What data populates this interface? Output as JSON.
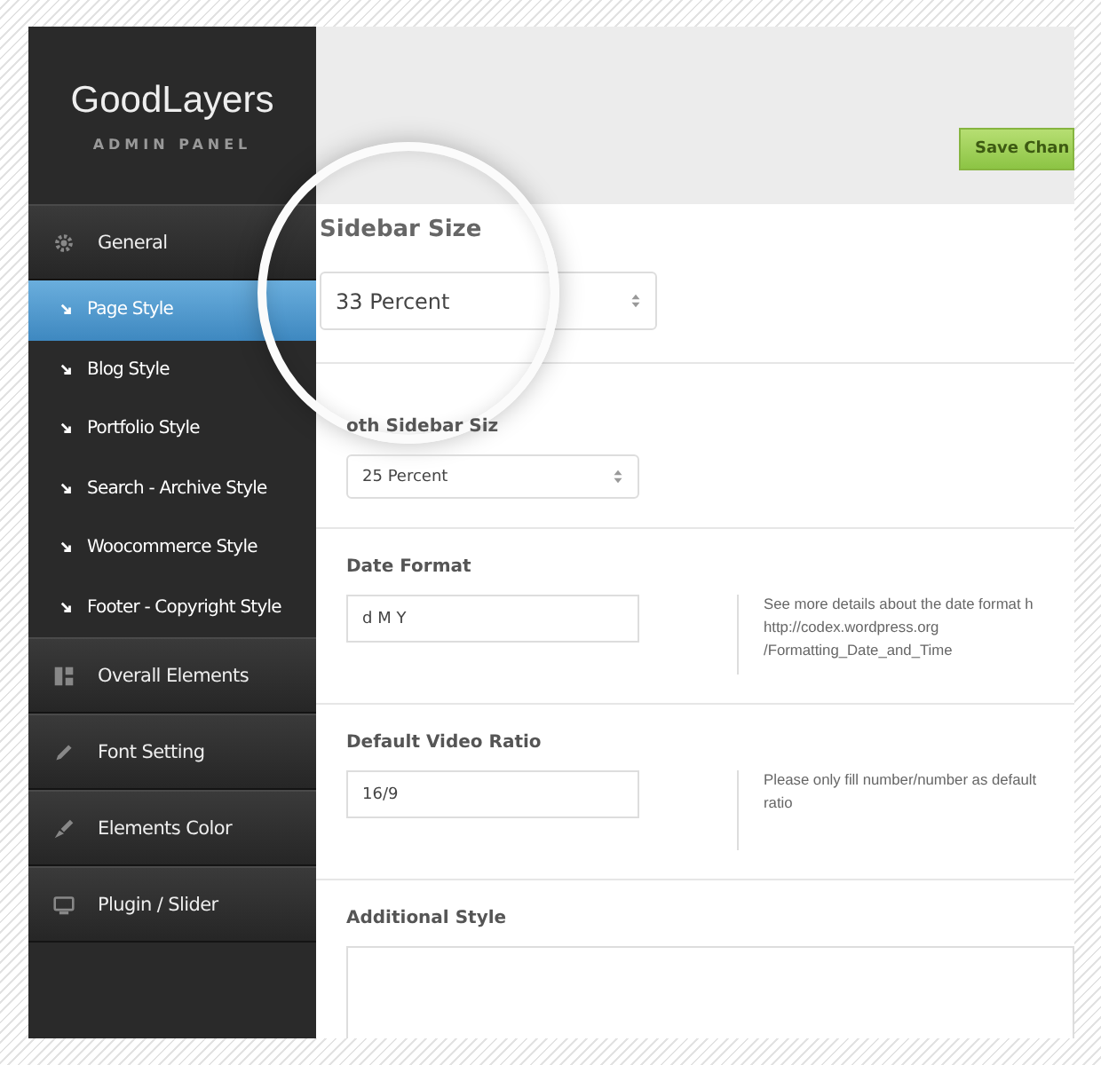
{
  "sidebar": {
    "logo": "GoodLayers",
    "subtitle": "ADMIN PANEL",
    "items": [
      {
        "kind": "section",
        "label": "General",
        "selected": false
      },
      {
        "kind": "sub",
        "label": "Page Style",
        "selected": true
      },
      {
        "kind": "sub",
        "label": "Blog Style",
        "selected": false
      },
      {
        "kind": "sub",
        "label": "Portfolio Style",
        "selected": false
      },
      {
        "kind": "sub",
        "label": "Search - Archive Style",
        "selected": false
      },
      {
        "kind": "sub",
        "label": "Woocommerce Style",
        "selected": false
      },
      {
        "kind": "sub",
        "label": "Footer - Copyright Style",
        "selected": false
      },
      {
        "kind": "section",
        "label": "Overall Elements",
        "selected": false
      },
      {
        "kind": "section",
        "label": "Font Setting",
        "selected": false
      },
      {
        "kind": "section",
        "label": "Elements Color",
        "selected": false
      },
      {
        "kind": "section",
        "label": "Plugin / Slider",
        "selected": false
      }
    ]
  },
  "save_button": "Save Chan",
  "fields": [
    {
      "kind": "select",
      "title": "Sidebar Size",
      "value": "33 Percent",
      "magnified": true
    },
    {
      "kind": "select",
      "title": "oth Sidebar Siz",
      "value": "25 Percent",
      "magnified": false
    },
    {
      "kind": "input",
      "title": "Date Format",
      "value": "d M Y",
      "description": [
        "See more details about the date format h",
        "http://codex.wordpress.org",
        "/Formatting_Date_and_Time"
      ]
    },
    {
      "kind": "input",
      "title": "Default Video Ratio",
      "value": "16/9",
      "description": [
        "Please only fill number/number as default",
        "ratio"
      ]
    },
    {
      "kind": "textarea",
      "title": "Additional Style"
    }
  ]
}
